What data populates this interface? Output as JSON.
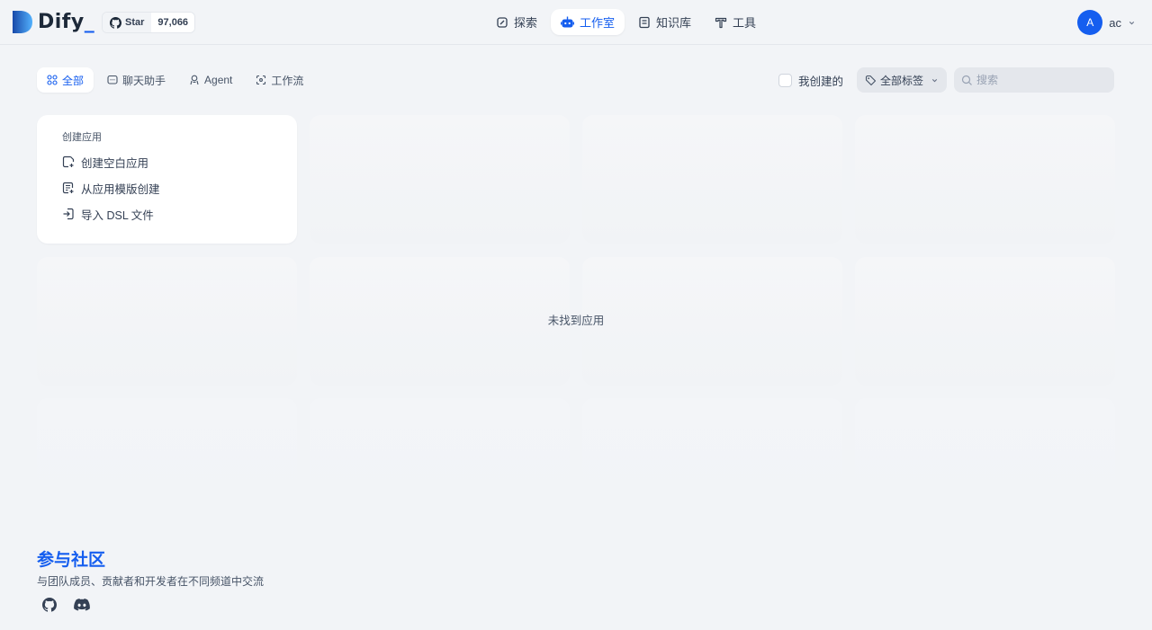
{
  "header": {
    "logo_text": "Dify",
    "logo_underscore": "_",
    "star_label": "Star",
    "star_count": "97,066",
    "nav": [
      {
        "label": "探索",
        "icon": "explore-icon"
      },
      {
        "label": "工作室",
        "icon": "robot-icon",
        "active": true
      },
      {
        "label": "知识库",
        "icon": "book-icon"
      },
      {
        "label": "工具",
        "icon": "tools-icon"
      }
    ],
    "user": {
      "avatar_letter": "A",
      "name": "ac"
    }
  },
  "tabs": [
    {
      "label": "全部",
      "icon": "grid-icon",
      "active": true
    },
    {
      "label": "聊天助手",
      "icon": "chat-icon"
    },
    {
      "label": "Agent",
      "icon": "agent-icon"
    },
    {
      "label": "工作流",
      "icon": "workflow-icon"
    }
  ],
  "filters": {
    "mine_label": "我创建的",
    "tag_label": "全部标签",
    "search_placeholder": "搜索"
  },
  "create_card": {
    "title": "创建应用",
    "items": [
      {
        "label": "创建空白应用",
        "icon": "new-file-icon"
      },
      {
        "label": "从应用模版创建",
        "icon": "template-icon"
      },
      {
        "label": "导入 DSL 文件",
        "icon": "import-icon"
      }
    ]
  },
  "empty_message": "未找到应用",
  "footer": {
    "title": "参与社区",
    "subtitle": "与团队成员、贡献者和开发者在不同频道中交流",
    "links": [
      {
        "icon": "github-icon"
      },
      {
        "icon": "discord-icon"
      }
    ]
  },
  "colors": {
    "accent": "#155eef",
    "background": "#f2f4f7"
  }
}
